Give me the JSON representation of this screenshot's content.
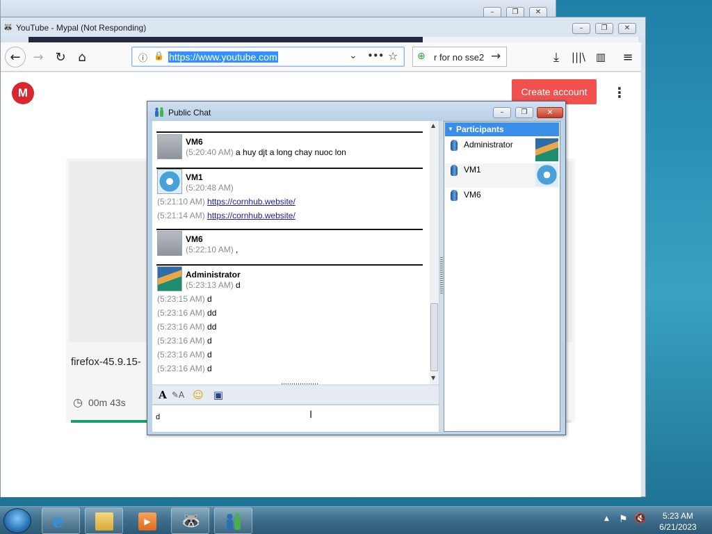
{
  "browser": {
    "title": "YouTube - Mypal (Not Responding)",
    "url": "https://www.youtube.com",
    "search_text": "r for no sse2"
  },
  "page": {
    "logo_letter": "M",
    "create_account_label": "Create account",
    "file_name": "firefox-45.9.15-",
    "timer": "00m 43s",
    "progress_fraction": 0.88
  },
  "chat": {
    "title": "Public Chat",
    "messages": [
      {
        "sender": "VM6",
        "time": "(5:20:40 AM)",
        "text": "a huy djt a long chay nuoc lon"
      },
      {
        "sender": "VM1",
        "time": "(5:20:48 AM)",
        "text": ""
      },
      {
        "time": "(5:21:10 AM)",
        "link": "https://cornhub.website/"
      },
      {
        "time": "(5:21:14 AM)",
        "link": "https://cornhub.website/"
      },
      {
        "sender": "VM6",
        "time": "(5:22:10 AM)",
        "text": ","
      },
      {
        "sender": "Administrator",
        "time": "(5:23:13 AM)",
        "text": "d"
      },
      {
        "time": "(5:23:15 AM)",
        "text": "d"
      },
      {
        "time": "(5:23:16 AM)",
        "text": "dd"
      },
      {
        "time": "(5:23:16 AM)",
        "text": "dd"
      },
      {
        "time": "(5:23:16 AM)",
        "text": "d"
      },
      {
        "time": "(5:23:16 AM)",
        "text": "d"
      },
      {
        "time": "(5:23:16 AM)",
        "text": "d"
      }
    ],
    "input_value": "d",
    "participants_header": "Participants",
    "participants": [
      "Administrator",
      "VM1",
      "VM6"
    ]
  },
  "taskbar": {
    "time": "5:23 AM",
    "date": "6/21/2023"
  },
  "colors": {
    "accent_button": "#f0514f",
    "progress": "#18a06a",
    "participants_header": "#3a8ee8",
    "link": "#1a1aa8"
  }
}
